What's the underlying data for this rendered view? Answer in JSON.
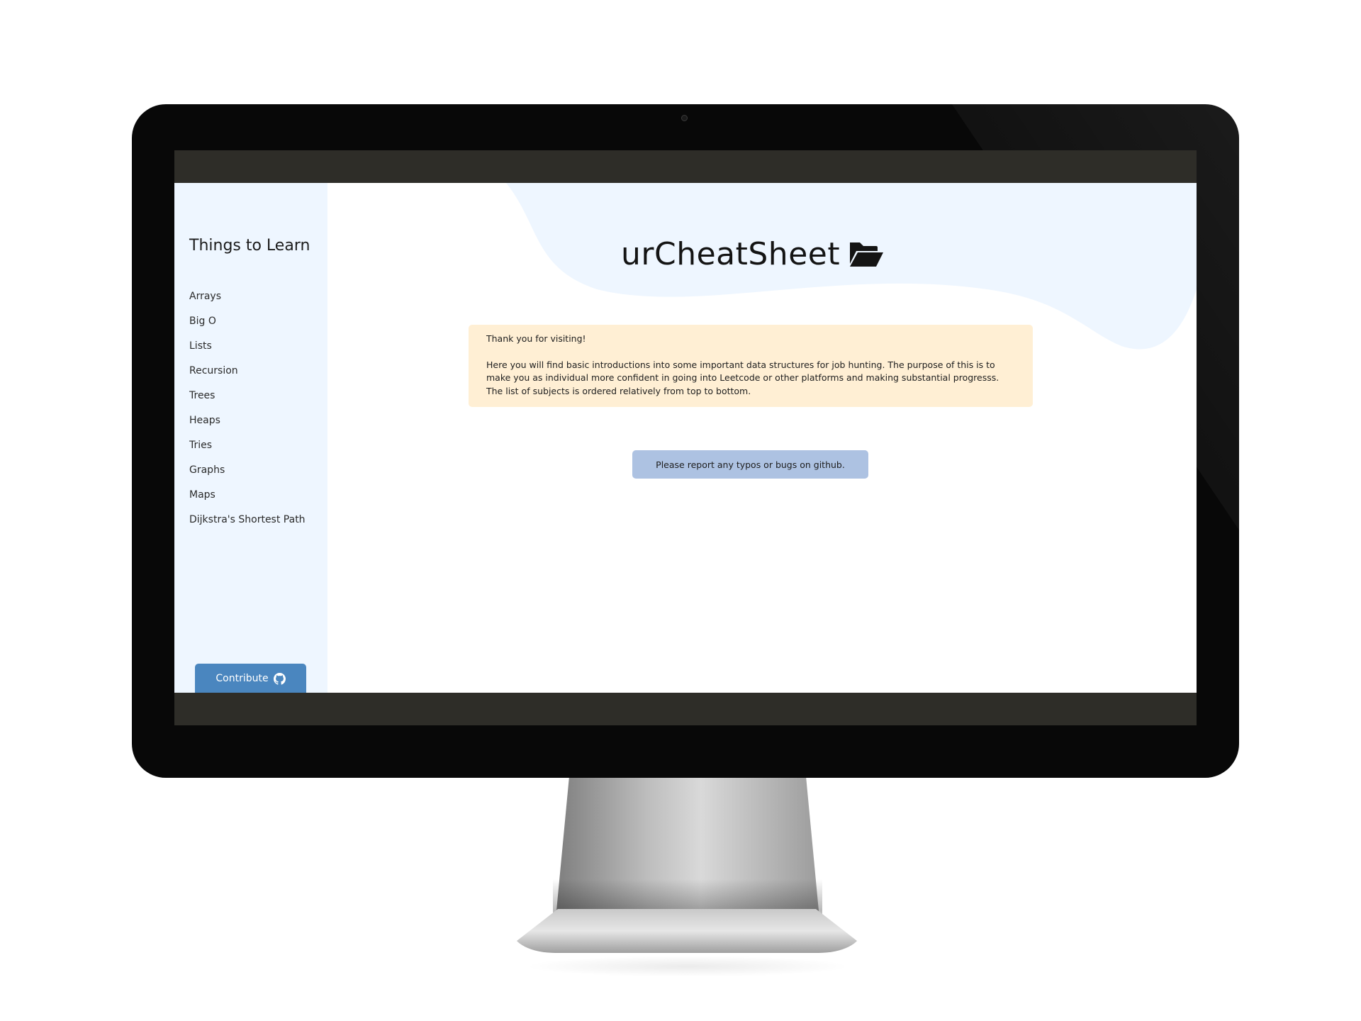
{
  "sidebar": {
    "title": "Things to Learn",
    "items": [
      {
        "label": "Arrays"
      },
      {
        "label": "Big O"
      },
      {
        "label": "Lists"
      },
      {
        "label": "Recursion"
      },
      {
        "label": "Trees"
      },
      {
        "label": "Heaps"
      },
      {
        "label": "Tries"
      },
      {
        "label": "Graphs"
      },
      {
        "label": "Maps"
      },
      {
        "label": "Dijkstra's Shortest Path"
      }
    ],
    "contribute_label": "Contribute",
    "contribute_icon": "github-icon"
  },
  "header": {
    "title": "urCheatSheet",
    "icon": "folder-open-icon"
  },
  "notice": {
    "greeting": "Thank you for visiting!",
    "body": "Here you will find basic introductions into some important data structures for job hunting. The purpose of this is to make you as individual more confident in going into Leetcode or other platforms and making substantial progresss. The list of subjects is ordered relatively from top to bottom."
  },
  "report": {
    "label": "Please report any typos or bugs on github."
  },
  "colors": {
    "sidebar_bg": "#eef6ff",
    "blob": "#eef6ff",
    "notice_bg": "#ffefd4",
    "report_bg": "#adc2e2",
    "contribute_bg": "#4a86bf",
    "bezel": "#080808"
  }
}
